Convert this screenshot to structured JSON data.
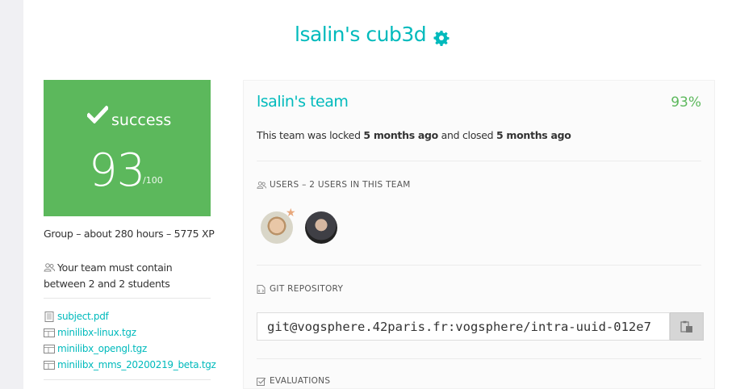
{
  "project": {
    "title": "lsalin's cub3d"
  },
  "score": {
    "status": "success",
    "value": "93",
    "max": "/100",
    "accent_color": "#5cb85c"
  },
  "info": {
    "group_line": "Group – about 280 hours – 5775 XP",
    "team_rule": "Your team must contain between 2 and 2 students"
  },
  "files": [
    {
      "name": "subject.pdf",
      "icon": "pdf-file-icon"
    },
    {
      "name": "minilibx-linux.tgz",
      "icon": "archive-file-icon"
    },
    {
      "name": "minilibx_opengl.tgz",
      "icon": "archive-file-icon"
    },
    {
      "name": "minilibx_mms_20200219_beta.tgz",
      "icon": "archive-file-icon"
    }
  ],
  "team": {
    "name": "lsalin's team",
    "percentage": "93%",
    "lock_prefix": "This team was locked ",
    "locked_ago": "5 months ago",
    "lock_middle": " and closed ",
    "closed_ago": "5 months ago",
    "users_header": "Users – 2 users in this team",
    "git_header": "Git repository",
    "git_url": "git@vogsphere.42paris.fr:vogsphere/intra-uuid-012e7",
    "evaluations_header": "Evaluations"
  }
}
